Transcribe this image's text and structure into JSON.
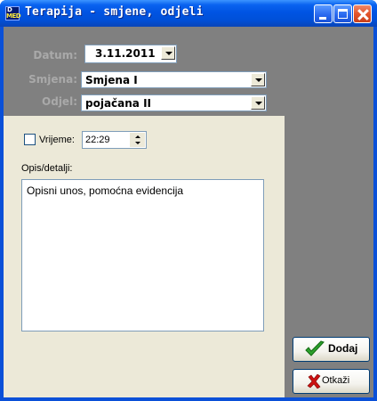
{
  "window": {
    "title": "Terapija - smjene, odjeli",
    "icon_top": "D",
    "icon_bottom": "MED"
  },
  "form": {
    "datum_label": "Datum:",
    "datum_value": "3.11.2011",
    "smjena_label": "Smjena:",
    "smjena_value": "Smjena I",
    "odjel_label": "Odjel:",
    "odjel_value": "pojačana II"
  },
  "vrijeme": {
    "label": "Vrijeme:",
    "value": "22:29",
    "checked": false
  },
  "opis": {
    "label": "Opis/detalji:",
    "value": "Opisni unos, pomoćna evidencija"
  },
  "buttons": {
    "dodaj": "Dodaj",
    "otkazi": "Otkaži"
  },
  "icons": {
    "app": "app-icon",
    "dodaj": "checkmark-icon",
    "otkazi": "x-icon"
  },
  "colors": {
    "titlebar": "#0054e3",
    "panel": "#808080",
    "form": "#ece9d8",
    "check": "#2ca02c",
    "cancel": "#cc1111"
  }
}
